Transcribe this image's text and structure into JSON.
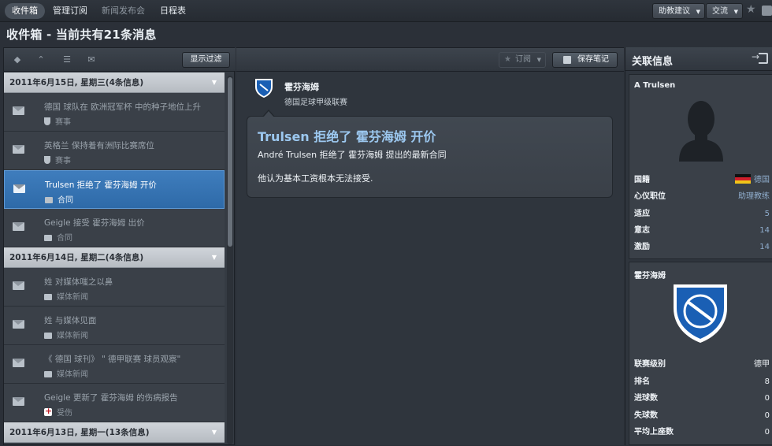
{
  "topbar": {
    "tabs": [
      {
        "label": "收件箱",
        "active": true
      },
      {
        "label": "管理订阅",
        "active": false
      },
      {
        "label": "新闻发布会",
        "active": false,
        "dimmed": true
      },
      {
        "label": "日程表",
        "active": false
      }
    ],
    "advice_label": "助教建议",
    "social_label": "交流"
  },
  "page_title": "收件箱 - 当前共有21条消息",
  "left": {
    "filter_button": "显示过滤",
    "groups": [
      {
        "header": "2011年6月15日, 星期三(4条信息)",
        "items": [
          {
            "title": "德国 球队在 欧洲冠军杯 中的种子地位上升",
            "category": "赛事",
            "icon": "shield-icon",
            "selected": false
          },
          {
            "title": "英格兰 保持着有洲际比赛席位",
            "category": "赛事",
            "icon": "shield-icon",
            "selected": false
          },
          {
            "title": "Trulsen 拒绝了 霍芬海姆 开价",
            "category": "合同",
            "icon": "contract-icon",
            "selected": true
          },
          {
            "title": "Geigle 接受 霍芬海姆 出价",
            "category": "合同",
            "icon": "contract-icon",
            "selected": false
          }
        ]
      },
      {
        "header": "2011年6月14日, 星期二(4条信息)",
        "items": [
          {
            "title": "姓 对媒体嗤之以鼻",
            "category": "媒体新闻",
            "icon": "newspaper-icon",
            "selected": false
          },
          {
            "title": "姓 与媒体见面",
            "category": "媒体新闻",
            "icon": "newspaper-icon",
            "selected": false
          },
          {
            "title": "《 德国 球刊》 \" 德甲联赛 球员观察\"",
            "category": "媒体新闻",
            "icon": "newspaper-icon",
            "selected": false
          },
          {
            "title": "Geigle 更新了 霍芬海姆 的伤病报告",
            "category": "受伤",
            "icon": "medical-cross-icon",
            "selected": false
          }
        ]
      },
      {
        "header": "2011年6月13日, 星期一(13条信息)",
        "items": []
      }
    ]
  },
  "middle": {
    "subscribe_label": "订阅",
    "save_label": "保存笔记",
    "club": "霍芬海姆",
    "league": "德国足球甲级联赛",
    "headline": "Trulsen 拒绝了 霍芬海姆 开价",
    "line1": "André Trulsen 拒绝了 霍芬海姆 提出的最新合同",
    "line2": "他认为基本工资根本无法接受."
  },
  "right": {
    "title": "关联信息",
    "person": {
      "name": "A Trulsen",
      "rows": [
        {
          "key": "国籍",
          "value": "德国",
          "flag": true
        },
        {
          "key": "心仪职位",
          "value": "助理教练"
        },
        {
          "key": "适应",
          "value": "5"
        },
        {
          "key": "意志",
          "value": "14"
        },
        {
          "key": "激励",
          "value": "14"
        }
      ]
    },
    "club": {
      "name": "霍芬海姆",
      "rows": [
        {
          "key": "联赛级别",
          "value": "德甲"
        },
        {
          "key": "排名",
          "value": "8"
        },
        {
          "key": "进球数",
          "value": "0"
        },
        {
          "key": "失球数",
          "value": "0"
        },
        {
          "key": "平均上座数",
          "value": "0"
        }
      ]
    }
  },
  "colors": {
    "selected_row": "#3f7dbd",
    "headline_blue": "#9cc8f0",
    "background": "#2b3038"
  }
}
